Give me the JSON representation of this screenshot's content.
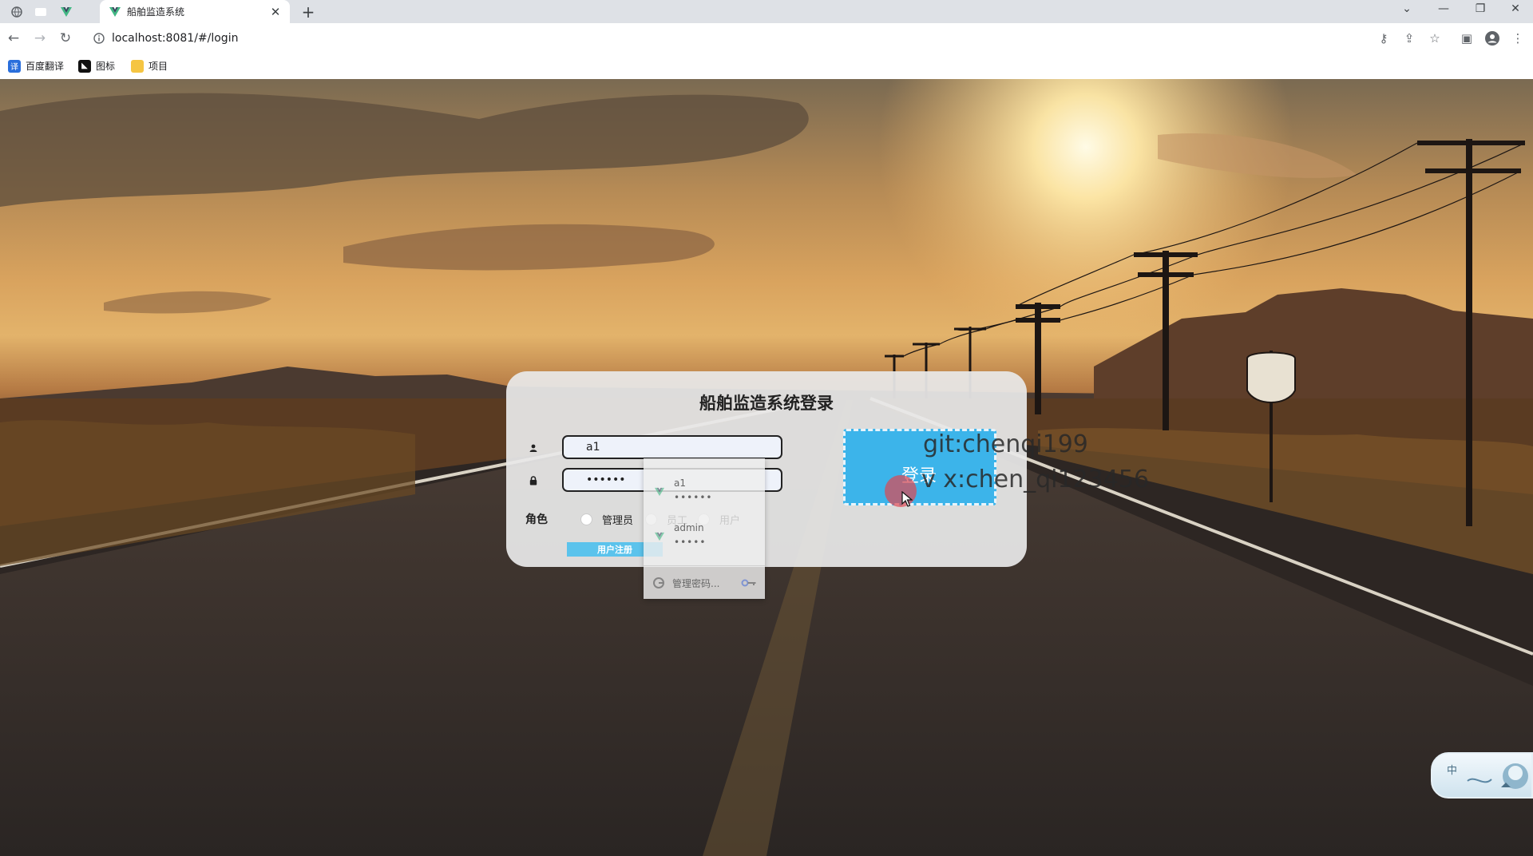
{
  "browser": {
    "tab_title": "船舶监造系统",
    "url": "localhost:8081/#/login",
    "bookmarks": [
      {
        "label": "百度翻译",
        "icon": "translate-icon"
      },
      {
        "label": "图标",
        "icon": "iconfont-icon"
      },
      {
        "label": "项目",
        "icon": "folder-icon"
      }
    ]
  },
  "login": {
    "title": "船舶监造系统登录",
    "username_value": "a1",
    "password_value": "••••••",
    "role_label": "角色",
    "roles": [
      "管理员",
      "员工",
      "用户"
    ],
    "register_label": "用户注册",
    "login_label": "登录",
    "watermark_line1": "git:chenqi199",
    "watermark_line2": "v x:chen_qi123456"
  },
  "autofill": {
    "items": [
      {
        "username": "a1",
        "password": "••••••"
      },
      {
        "username": "admin",
        "password": "•••••"
      }
    ],
    "manage_label": "管理密码..."
  },
  "ime": {
    "mode": "中"
  },
  "colors": {
    "accent": "#3cb4ea",
    "register": "#5bc3ec",
    "card": "#e8e8e8"
  }
}
